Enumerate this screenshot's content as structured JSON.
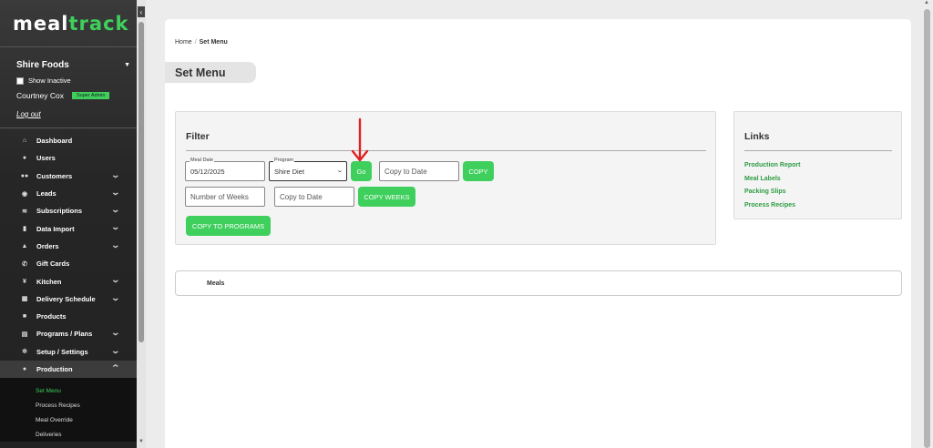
{
  "brand": {
    "part1": "meal",
    "part2": "track"
  },
  "sidebar": {
    "org_name": "Shire Foods",
    "show_inactive": "Show Inactive",
    "user_name": "Courtney Cox",
    "role_badge": "Super Admin",
    "logout": "Log out",
    "nav": [
      {
        "label": "Dashboard",
        "icon": "home-icon",
        "expandable": false
      },
      {
        "label": "Users",
        "icon": "user-icon",
        "expandable": false
      },
      {
        "label": "Customers",
        "icon": "users-icon",
        "expandable": true
      },
      {
        "label": "Leads",
        "icon": "target-icon",
        "expandable": true
      },
      {
        "label": "Subscriptions",
        "icon": "layers-icon",
        "expandable": true
      },
      {
        "label": "Data Import",
        "icon": "file-icon",
        "expandable": true
      },
      {
        "label": "Orders",
        "icon": "bag-icon",
        "expandable": true
      },
      {
        "label": "Gift Cards",
        "icon": "phone-icon",
        "expandable": false
      },
      {
        "label": "Kitchen",
        "icon": "utensils-icon",
        "expandable": true
      },
      {
        "label": "Delivery Schedule",
        "icon": "calendar-icon",
        "expandable": true
      },
      {
        "label": "Products",
        "icon": "box-icon",
        "expandable": false
      },
      {
        "label": "Programs / Plans",
        "icon": "clipboard-icon",
        "expandable": true
      },
      {
        "label": "Setup / Settings",
        "icon": "gear-icon",
        "expandable": true
      },
      {
        "label": "Production",
        "icon": "person-icon",
        "expandable": true,
        "active": true
      }
    ],
    "subnav": [
      {
        "label": "Set Menu",
        "active": true
      },
      {
        "label": "Process Recipes"
      },
      {
        "label": "Meal Override"
      },
      {
        "label": "Deliveries"
      }
    ]
  },
  "breadcrumb": {
    "home": "Home",
    "separator": "/",
    "current": "Set Menu"
  },
  "page_title": "Set Menu",
  "filter": {
    "title": "Filter",
    "meal_date_label": "Meal Date",
    "meal_date_value": "05/12/2025",
    "program_label": "Program",
    "program_value": "Shire Diet",
    "go_button": "Go",
    "copy_to_date_placeholder": "Copy to Date",
    "copy_button": "COPY",
    "weeks_placeholder": "Number of Weeks",
    "copy_to_date_placeholder_2": "Copy to Date",
    "copy_weeks_button": "COPY WEEKS",
    "copy_to_programs_button": "COPY TO PROGRAMS"
  },
  "links": {
    "title": "Links",
    "items": [
      "Production Report",
      "Meal Labels",
      "Packing Slips",
      "Process Recipes"
    ]
  },
  "meals_section": "Meals",
  "colors": {
    "accent": "#3ecf5c",
    "link": "#2e9c44",
    "arrow": "#e02020",
    "sidebar_bg": "#262626"
  }
}
